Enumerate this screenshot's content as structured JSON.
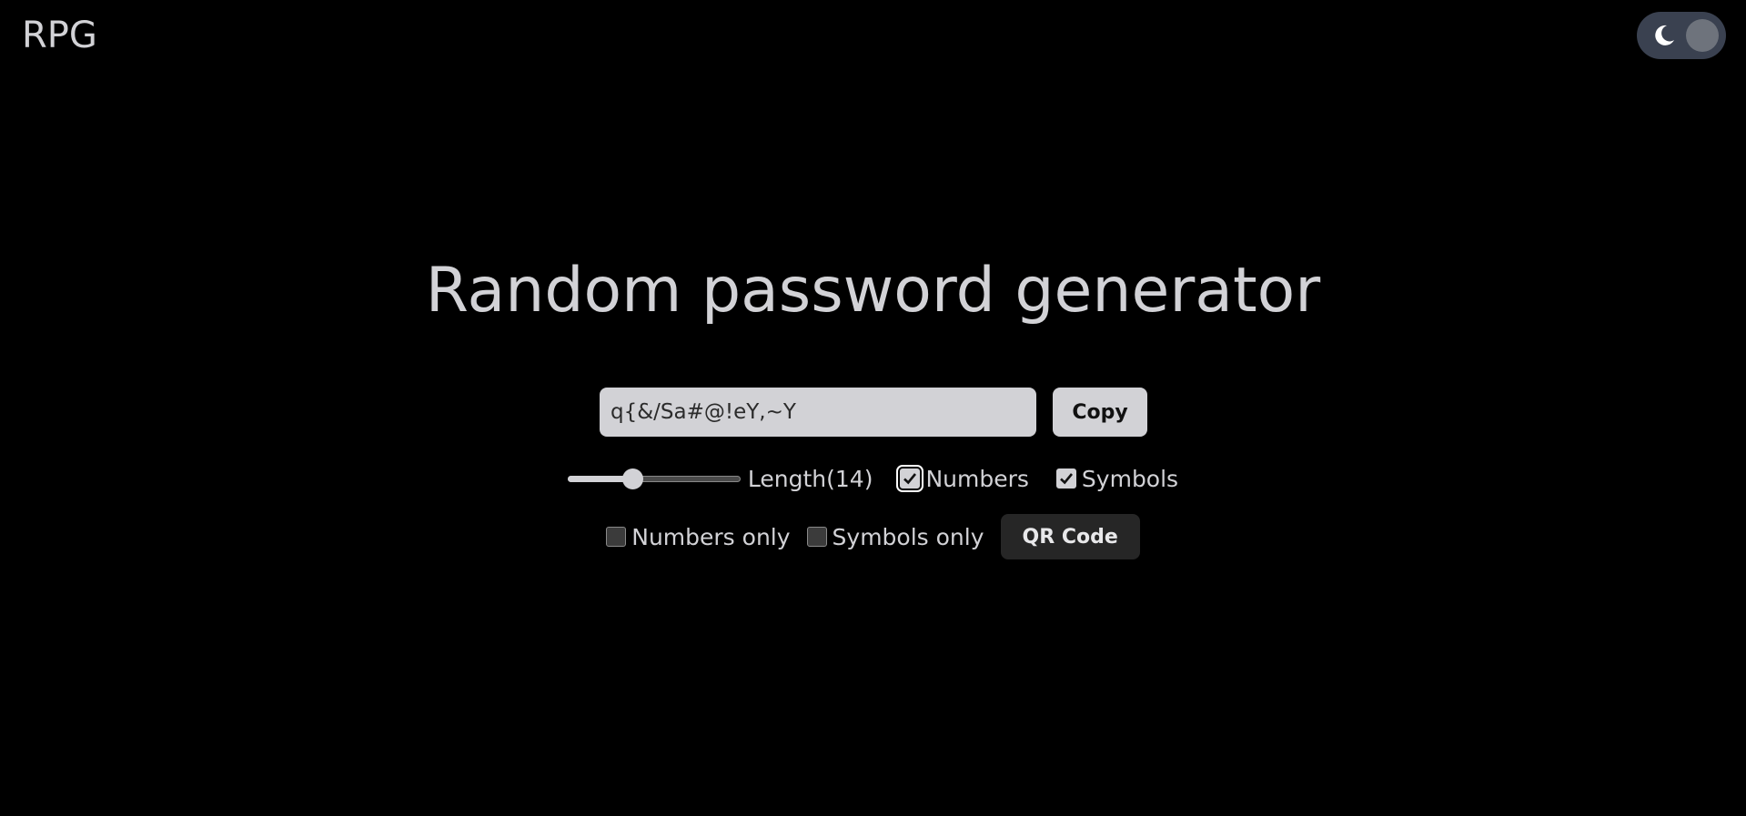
{
  "app": {
    "logo": "RPG"
  },
  "theme_toggle": {
    "icon": "moon-icon",
    "mode": "dark",
    "track_color": "#3a4150",
    "knob_color": "#6e737c"
  },
  "main": {
    "title": "Random password generator",
    "password_value": "q{&/Sa#@!eY,~Y",
    "copy_label": "Copy",
    "length": {
      "label": "Length(14)",
      "value": 14,
      "min": 4,
      "max": 32
    },
    "options": {
      "numbers": {
        "label": "Numbers",
        "checked": true
      },
      "symbols": {
        "label": "Symbols",
        "checked": true
      },
      "numbers_only": {
        "label": "Numbers only",
        "checked": false
      },
      "symbols_only": {
        "label": "Symbols only",
        "checked": false
      }
    },
    "qr_label": "QR Code"
  },
  "colors": {
    "background": "#000000",
    "text": "#d2d2d6",
    "input_bg": "#d2d2d6",
    "qr_button_bg": "#262626"
  }
}
